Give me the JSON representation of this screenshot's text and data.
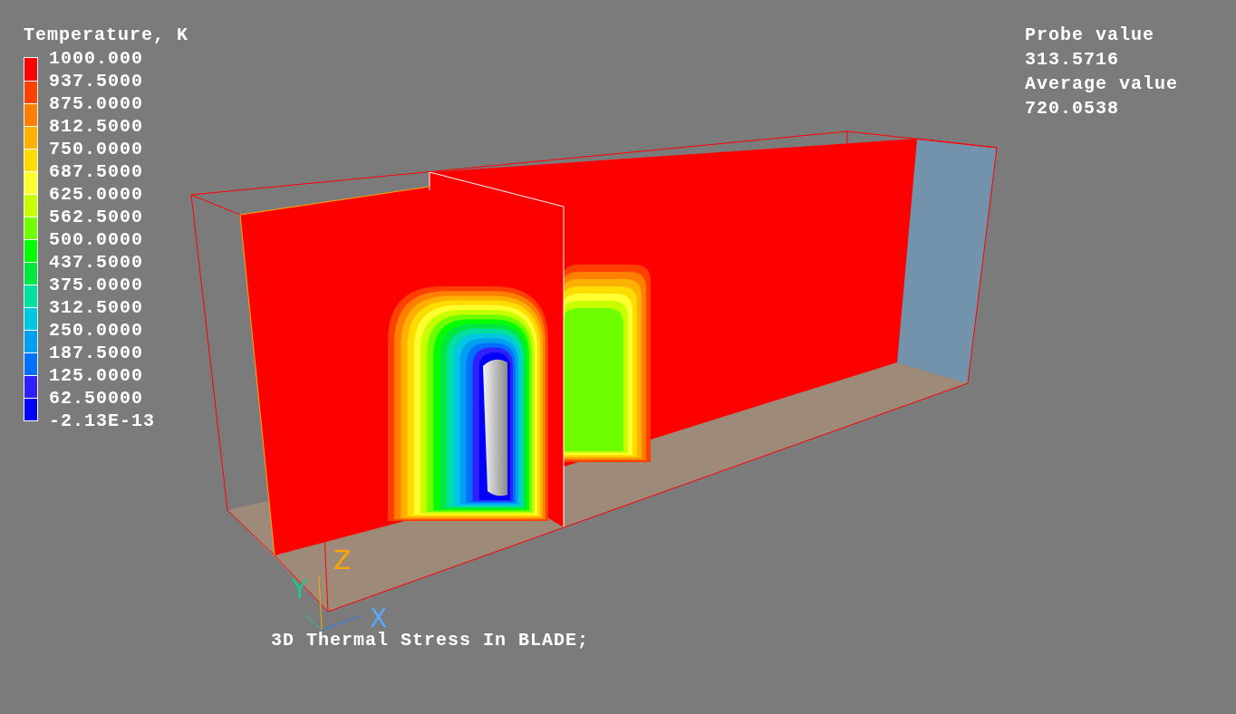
{
  "legend": {
    "title": "Temperature, K",
    "bands": [
      {
        "color": "#ff0000"
      },
      {
        "color": "#ff4000"
      },
      {
        "color": "#ff8000"
      },
      {
        "color": "#ffb000"
      },
      {
        "color": "#ffdc00"
      },
      {
        "color": "#ffff30"
      },
      {
        "color": "#c8ff00"
      },
      {
        "color": "#70ff00"
      },
      {
        "color": "#00ff00"
      },
      {
        "color": "#00e840"
      },
      {
        "color": "#00e0a0"
      },
      {
        "color": "#00c8e0"
      },
      {
        "color": "#00a0f0"
      },
      {
        "color": "#0070ff"
      },
      {
        "color": "#3020ff"
      },
      {
        "color": "#0000ff"
      }
    ],
    "labels": [
      "1000.000",
      "937.5000",
      "875.0000",
      "812.5000",
      "750.0000",
      "687.5000",
      "625.0000",
      "562.5000",
      "500.0000",
      "437.5000",
      "375.0000",
      "312.5000",
      "250.0000",
      "187.5000",
      "125.0000",
      "62.50000",
      "-2.13E-13"
    ]
  },
  "readouts": [
    {
      "label": "Probe value",
      "value": "313.5716"
    },
    {
      "label": "Average value",
      "value": "720.0538"
    }
  ],
  "axes": [
    {
      "name": "X",
      "color": "#5aa8ff"
    },
    {
      "name": "Y",
      "color": "#20c890"
    },
    {
      "name": "Z",
      "color": "#ffa500"
    }
  ],
  "caption": "3D Thermal Stress In BLADE;"
}
